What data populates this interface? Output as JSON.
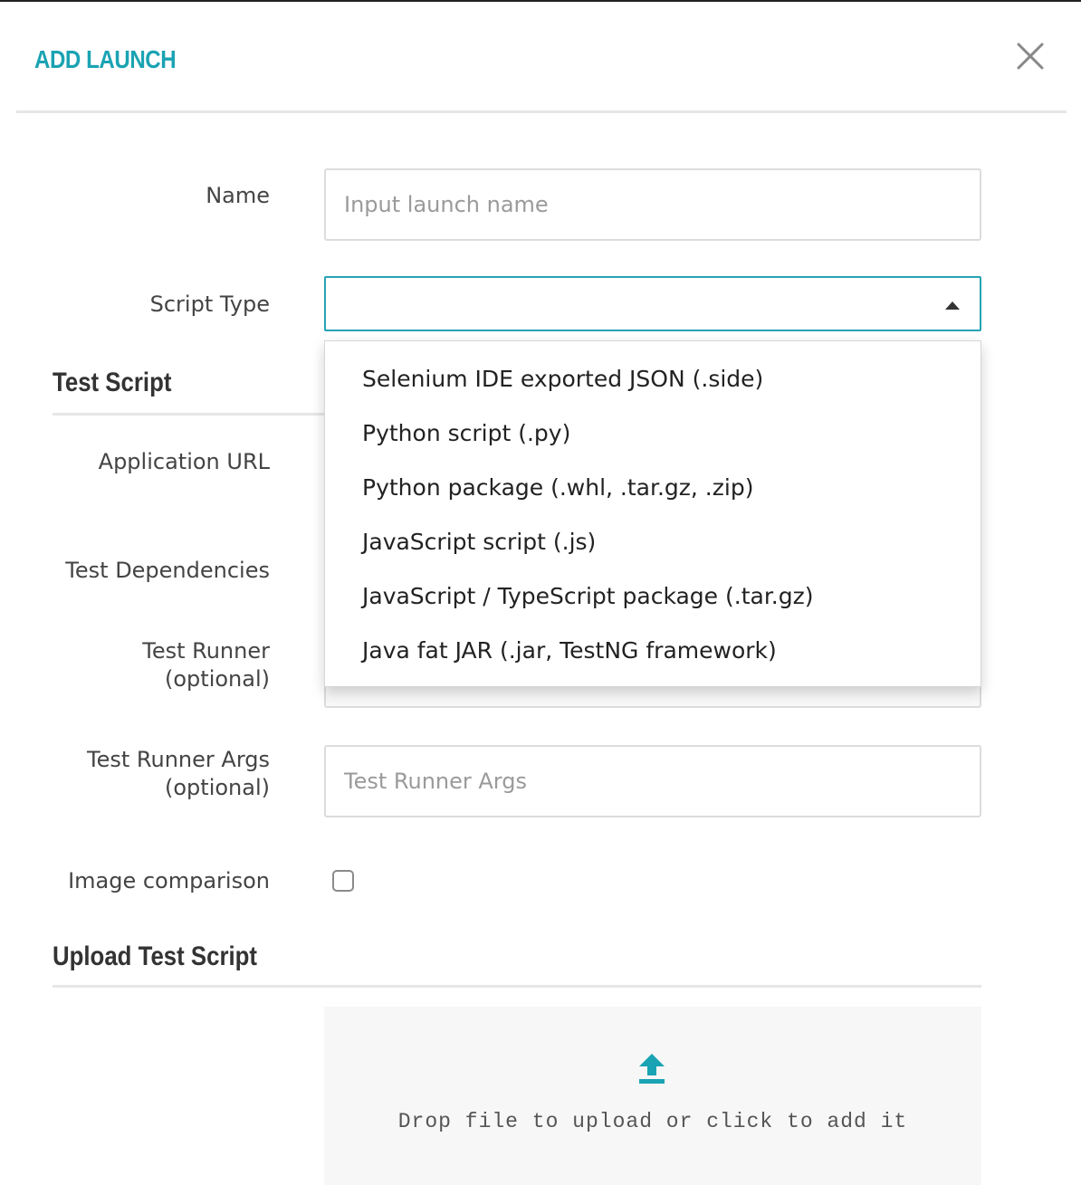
{
  "modal": {
    "title": "ADD LAUNCH"
  },
  "form": {
    "name": {
      "label": "Name",
      "placeholder": "Input launch name",
      "value": ""
    },
    "script_type": {
      "label": "Script Type",
      "value": "",
      "options": [
        "Selenium IDE exported JSON (.side)",
        "Python script (.py)",
        "Python package (.whl, .tar.gz, .zip)",
        "JavaScript script (.js)",
        "JavaScript / TypeScript package (.tar.gz)",
        "Java fat JAR (.jar, TestNG framework)"
      ]
    },
    "test_script_section": "Test Script",
    "application_url": {
      "label": "Application URL"
    },
    "test_dependencies": {
      "label": "Test Dependencies"
    },
    "test_runner": {
      "label": "Test Runner",
      "optional": "(optional)"
    },
    "test_runner_args": {
      "label": "Test Runner Args",
      "optional": "(optional)",
      "placeholder": "Test Runner Args",
      "value": ""
    },
    "image_comparison": {
      "label": "Image comparison",
      "checked": false
    },
    "upload_section": "Upload Test Script",
    "upload": {
      "text": "Drop file to upload or click to add it",
      "icon": "upload-icon"
    }
  },
  "icons": {
    "close": "close-icon",
    "caret": "caret-up-icon"
  },
  "colors": {
    "accent": "#1aa3b3",
    "border_focus": "#27a3b4"
  }
}
